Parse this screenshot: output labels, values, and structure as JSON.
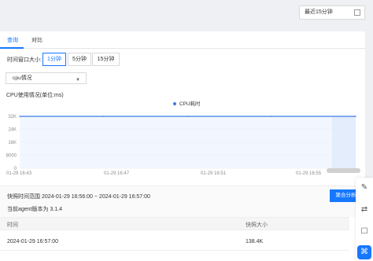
{
  "topbar": {
    "time_range_value": "最近15分钟"
  },
  "tabs": [
    {
      "label": "查询"
    },
    {
      "label": "对比"
    }
  ],
  "window_size": {
    "label": "时间窗口大小:",
    "options": [
      "1分钟",
      "5分钟",
      "15分钟"
    ],
    "selected": "1分钟"
  },
  "metric_select": {
    "value": "cpu情况"
  },
  "chart_title": "CPU使用情况(单位:ms)",
  "chart_data": {
    "type": "area",
    "title": "CPU使用情况(单位:ms)",
    "legend_position": "top-center",
    "series": [
      {
        "name": "CPU耗时",
        "x": [
          "01-29 16:43",
          "01-29 16:47",
          "01-29 16:51",
          "01-29 16:55",
          "01-29 16:57"
        ],
        "y": [
          32000,
          32000,
          32000,
          32000,
          32000
        ]
      }
    ],
    "y_ticks": [
      "32K",
      "24K",
      "16K",
      "8000",
      "0"
    ],
    "ylim": [
      0,
      32000
    ],
    "x_ticks": [
      "01-29 16:43",
      "01-29 16:47",
      "01-29 16:51",
      "01-29 16:55"
    ],
    "grid": true,
    "highlight_range": [
      "01-29 16:56",
      "01-29 16:57"
    ],
    "colors": {
      "line": "#3b7be6",
      "area": "#e7f0ff",
      "highlight": "#dfe8f8",
      "grid": "#e8e8e8"
    }
  },
  "snapshot": {
    "range_label": "快照时间范围  2024-01-29 16:56:00 ~ 2024-01-29 16:57:00",
    "agent_label": "当前agent版本为 3.1.4",
    "aggregate_button": "聚合分析"
  },
  "table": {
    "headers": [
      "时间",
      "快照大小"
    ],
    "rows": [
      {
        "time": "2024-01-29 16:57:00",
        "size": "138.4K"
      }
    ]
  },
  "tools": [
    {
      "icon": "edit-icon"
    },
    {
      "icon": "share-icon"
    },
    {
      "icon": "comment-icon"
    },
    {
      "icon": "apps-icon"
    }
  ]
}
